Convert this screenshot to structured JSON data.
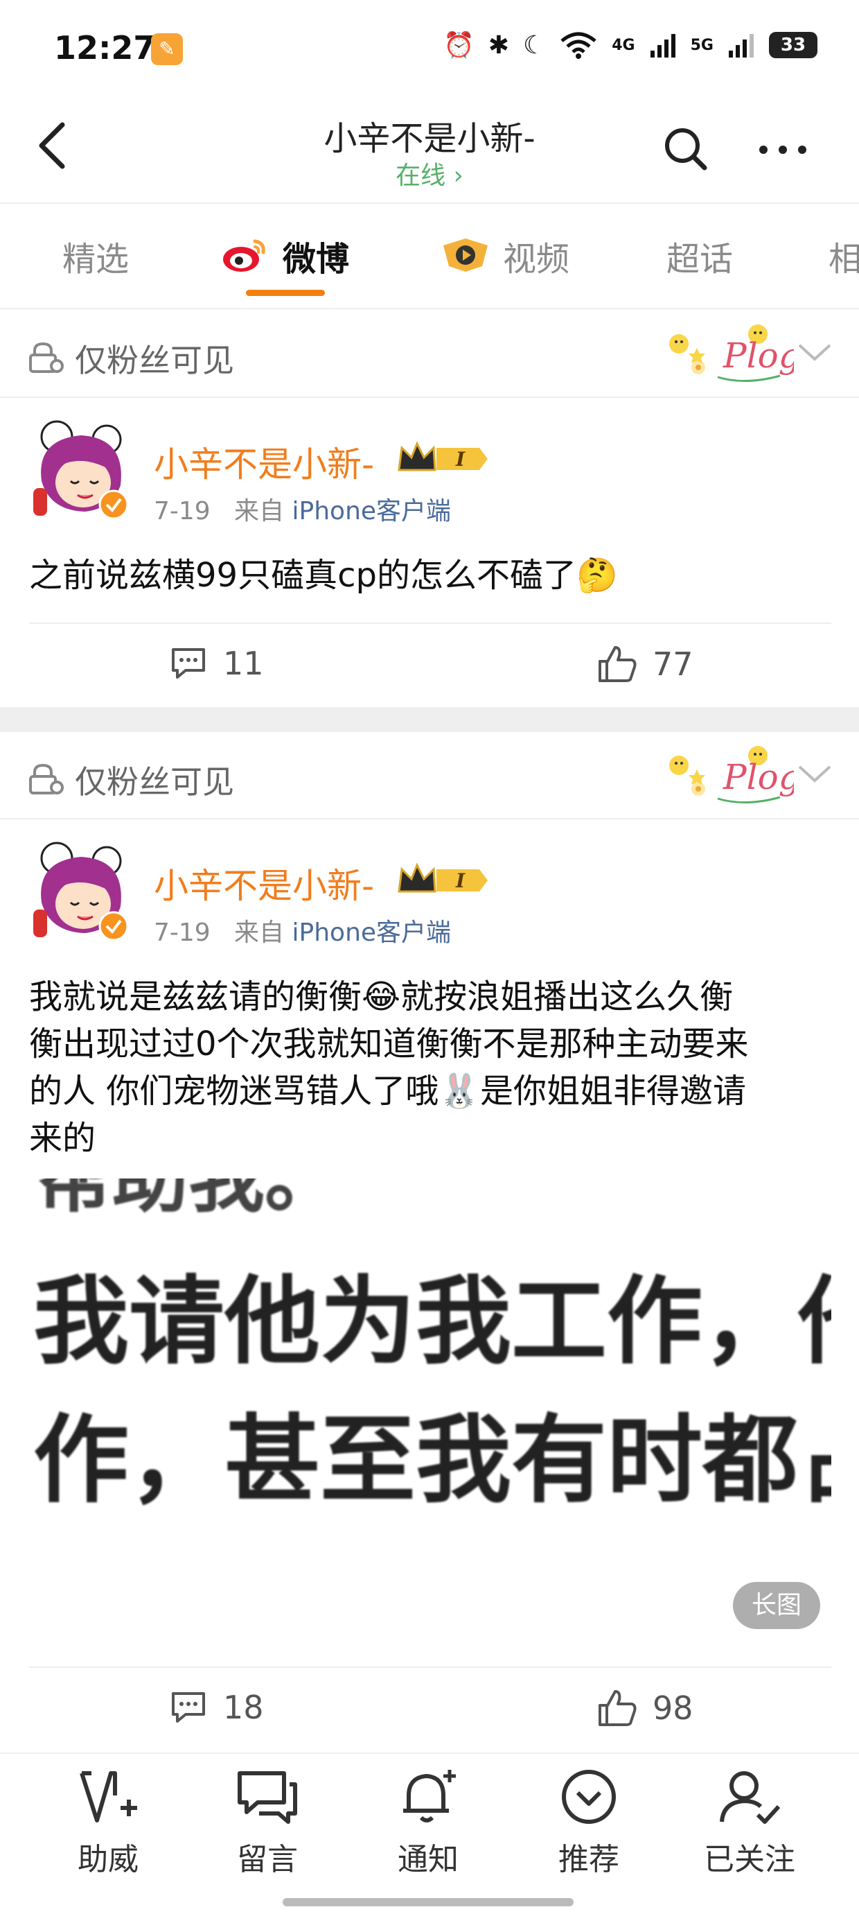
{
  "status_bar": {
    "time": "12:27",
    "net1": "4G",
    "net2": "5G",
    "battery": "33"
  },
  "header": {
    "title": "小辛不是小新-",
    "subtitle": "在线 ›"
  },
  "tabs": [
    {
      "label": "精选"
    },
    {
      "label": "微博"
    },
    {
      "label": "视频"
    },
    {
      "label": "超话"
    },
    {
      "label": "相"
    }
  ],
  "posts": [
    {
      "visibility": "仅粉丝可见",
      "user_name": "小辛不是小新-",
      "level_badge": "I",
      "date": "7-19",
      "source_prefix": "来自",
      "source": "iPhone客户端",
      "text": "之前说兹横99只磕真cp的怎么不磕了🤔",
      "comments": "11",
      "likes": "77"
    },
    {
      "visibility": "仅粉丝可见",
      "user_name": "小辛不是小新-",
      "level_badge": "I",
      "date": "7-19",
      "source_prefix": "来自",
      "source": "iPhone客户端",
      "text_lines": [
        "我就说是兹兹请的衡衡😂就按浪姐播出这么久衡",
        "衡出现过过0个次我就知道衡衡不是那种主动要来",
        "的人 你们宠物迷骂错人了哦🐰是你姐姐非得邀请",
        "来的"
      ],
      "image_text_top": "帮助我。",
      "image_text_line1": "我请他为我工作，他",
      "image_text_line2": "作，甚至我有时都占",
      "image_badge": "长图",
      "comments": "18",
      "likes": "98"
    }
  ],
  "plog_label": "Plog",
  "bottom_nav": [
    {
      "label": "助威",
      "icon": "cheer-icon"
    },
    {
      "label": "留言",
      "icon": "message-icon"
    },
    {
      "label": "通知",
      "icon": "bell-icon"
    },
    {
      "label": "推荐",
      "icon": "recommend-icon"
    },
    {
      "label": "已关注",
      "icon": "followed-icon"
    }
  ],
  "colors": {
    "accent": "#f27f0f",
    "username": "#f17d1c",
    "online": "#57b06a",
    "source": "#4a6a9a"
  }
}
